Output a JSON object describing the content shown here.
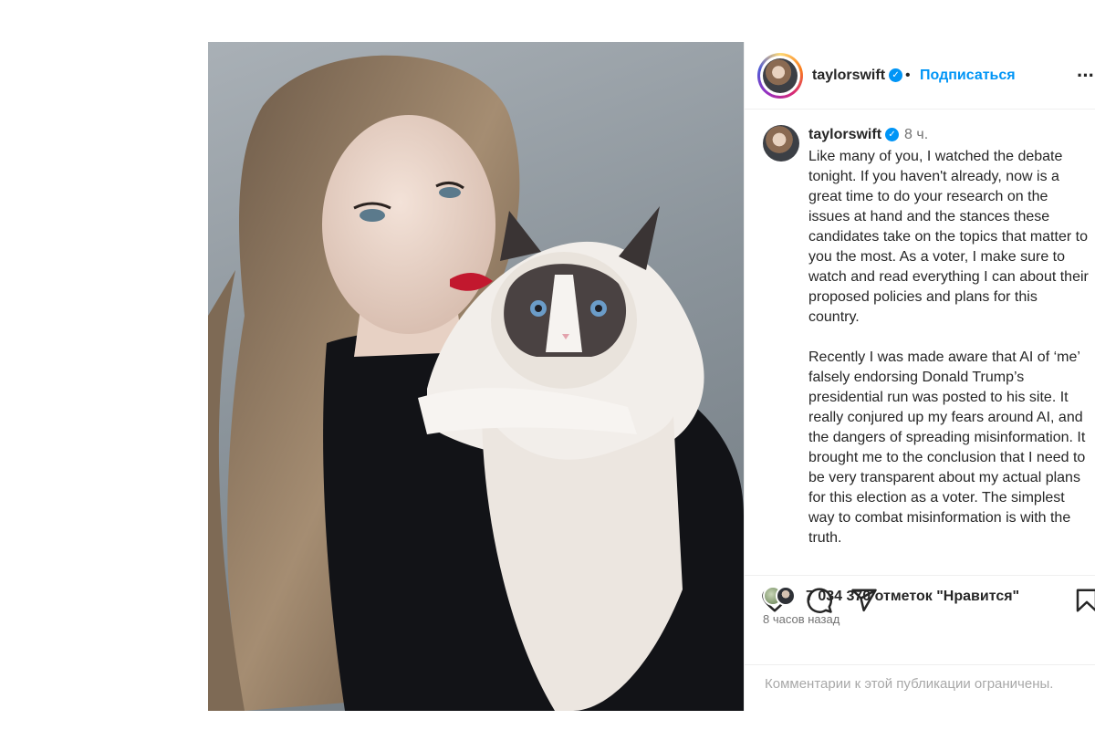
{
  "post": {
    "username": "taylorswift",
    "follow_label": "Подписаться",
    "header_separator": "•",
    "more_glyph": "···",
    "verified_glyph": "✓",
    "caption_time": "8 ч.",
    "caption_paragraphs": [
      "Like many of you, I watched the debate tonight. If you haven't already, now is a great time to do your research on the issues at hand and the stances these candidates take on the topics that matter to you the most. As a voter, I make sure to watch and read everything I can about their proposed policies and plans for this country.",
      "Recently I was made aware that AI of ‘me’ falsely endorsing Donald Trump’s presidential run was posted to his site. It really conjured up my fears around AI, and the dangers of spreading misinformation. It brought me to the conclusion that I need to be very transparent about my actual plans for this election as a voter. The simplest way to combat misinformation is with the truth."
    ],
    "likes_text": "7 034 370 отметок \"Нравится\"",
    "age_text": "8 часов назад",
    "comments_restricted_text": "Комментарии к этой публикации ограничены."
  },
  "icons": {
    "like": "heart-icon",
    "comment": "comment-icon",
    "share": "paper-plane-icon",
    "save": "bookmark-icon",
    "verified": "verified-badge-icon",
    "more": "more-options-icon"
  },
  "colors": {
    "accent": "#0095f6",
    "text": "#262626",
    "muted": "#737373",
    "border": "#efefef"
  }
}
